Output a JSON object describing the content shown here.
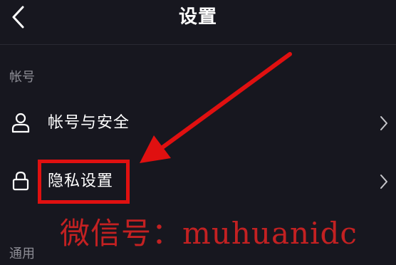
{
  "header": {
    "title": "设置",
    "back_icon": "chevron-left-icon"
  },
  "sections": {
    "account": {
      "label": "帐号"
    },
    "general": {
      "label": "通用"
    }
  },
  "rows": [
    {
      "label": "帐号与安全",
      "icon": "person-icon",
      "chevron": "chevron-right-icon"
    },
    {
      "label": "隐私设置",
      "icon": "lock-icon",
      "chevron": "chevron-right-icon"
    }
  ],
  "annotation": {
    "color": "#e01010"
  },
  "watermark": {
    "text": "微信号：muhuanidc"
  }
}
